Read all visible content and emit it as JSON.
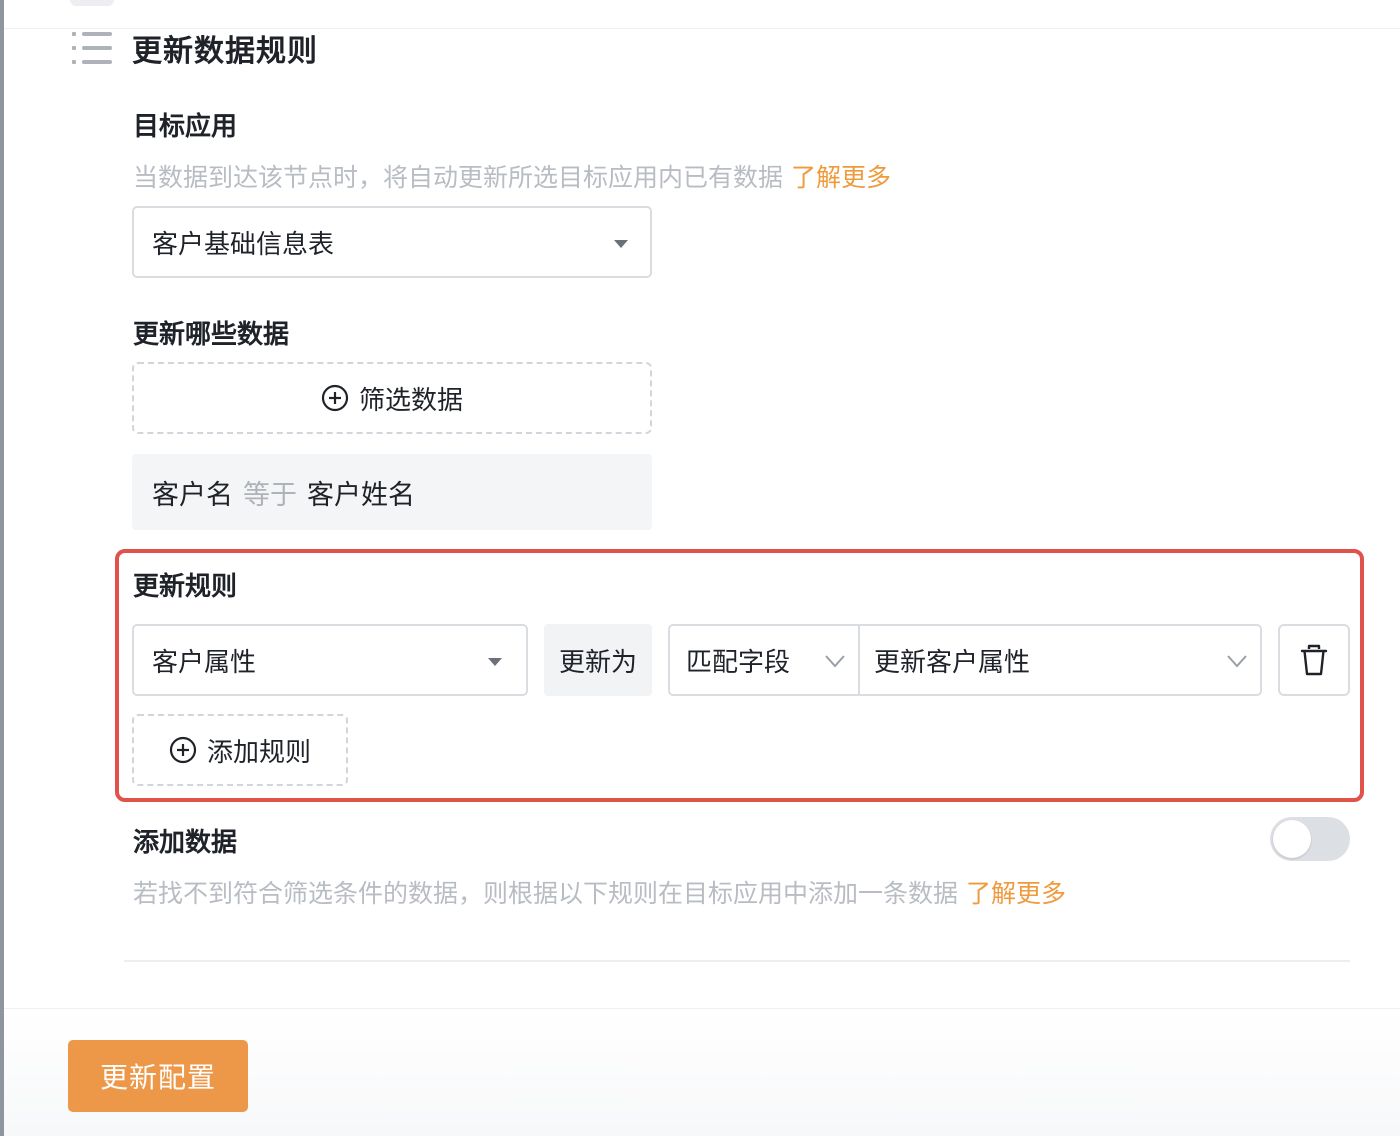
{
  "header": {
    "title": "更新数据规则",
    "icon": "list-icon"
  },
  "target_app": {
    "label": "目标应用",
    "description": "当数据到达该节点时，将自动更新所选目标应用内已有数据",
    "learn_more": "了解更多",
    "selected": "客户基础信息表"
  },
  "which_data": {
    "label": "更新哪些数据",
    "filter_button": "筛选数据",
    "condition": {
      "field": "客户名",
      "operator": "等于",
      "value": "客户姓名"
    }
  },
  "update_rules": {
    "label": "更新规则",
    "rules": [
      {
        "field": "客户属性",
        "action": "更新为",
        "mode": "匹配字段",
        "target": "更新客户属性",
        "delete_icon": "trash-icon"
      }
    ],
    "add_button": "添加规则"
  },
  "add_data": {
    "label": "添加数据",
    "description": "若找不到符合筛选条件的数据，则根据以下规则在目标应用中添加一条数据",
    "learn_more": "了解更多",
    "toggle_on": false
  },
  "footer": {
    "submit_label": "更新配置"
  },
  "colors": {
    "accent": "#ed9848",
    "link": "#ef9a3d",
    "highlight_border": "#e0524a"
  }
}
